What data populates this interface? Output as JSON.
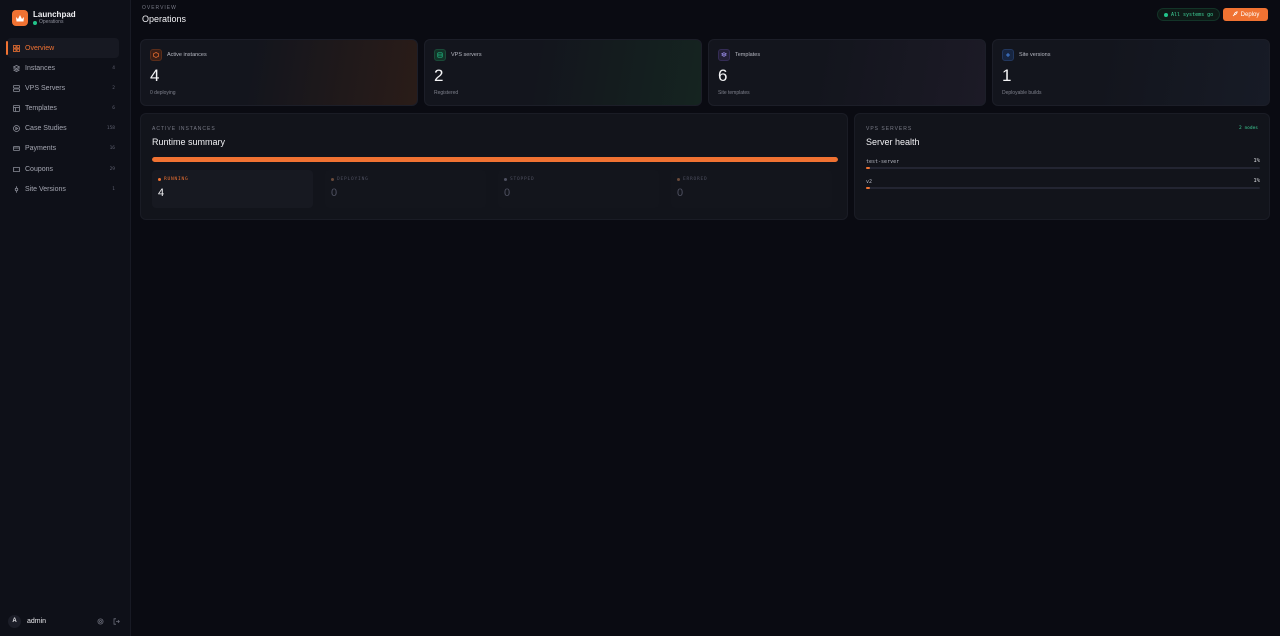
{
  "brand": {
    "name": "Launchpad",
    "subtitle": "Operations"
  },
  "sidebar": {
    "items": [
      {
        "label": "Overview",
        "count": "",
        "icon": "grid-icon",
        "active": true
      },
      {
        "label": "Instances",
        "count": "4",
        "icon": "layers-icon"
      },
      {
        "label": "VPS Servers",
        "count": "2",
        "icon": "server-icon"
      },
      {
        "label": "Templates",
        "count": "6",
        "icon": "template-icon"
      },
      {
        "label": "Case Studies",
        "count": "158",
        "icon": "play-circle-icon"
      },
      {
        "label": "Payments",
        "count": "16",
        "icon": "credit-card-icon"
      },
      {
        "label": "Coupons",
        "count": "29",
        "icon": "ticket-icon"
      },
      {
        "label": "Site Versions",
        "count": "1",
        "icon": "git-branch-icon"
      }
    ]
  },
  "user": {
    "initial": "A",
    "name": "admin"
  },
  "header": {
    "breadcrumb": "OVERVIEW",
    "title": "Operations",
    "status": "All systems go",
    "deploy_label": "Deploy"
  },
  "stats": [
    {
      "label": "Active instances",
      "value": "4",
      "sub": "0 deploying",
      "icon": "box-icon",
      "color": "#f07232"
    },
    {
      "label": "VPS servers",
      "value": "2",
      "sub": "Registered",
      "icon": "server-icon",
      "color": "#22c58b"
    },
    {
      "label": "Templates",
      "value": "6",
      "sub": "Site templates",
      "icon": "layers-icon",
      "color": "#8b7cf0"
    },
    {
      "label": "Site versions",
      "value": "1",
      "sub": "Deployable builds",
      "icon": "plus-icon",
      "color": "#4a8cf0"
    }
  ],
  "runtime": {
    "kicker": "ACTIVE INSTANCES",
    "title": "Runtime summary",
    "progress": 1.0,
    "statuses": [
      {
        "label": "RUNNING",
        "value": "4"
      },
      {
        "label": "DEPLOYING",
        "value": "0"
      },
      {
        "label": "STOPPED",
        "value": "0"
      },
      {
        "label": "ERRORED",
        "value": "0"
      }
    ]
  },
  "servers": {
    "kicker": "VPS SERVERS",
    "title": "Server health",
    "count": "2 nodes",
    "items": [
      {
        "name": "test-server",
        "pct": "1%",
        "load": 0.01
      },
      {
        "name": "v2",
        "pct": "1%",
        "load": 0.01
      }
    ]
  }
}
